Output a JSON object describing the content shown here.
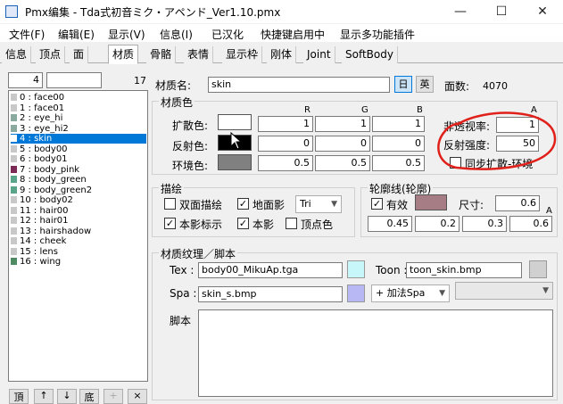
{
  "window": {
    "title": "Pmx编集 - Tda式初音ミク・アペンド_Ver1.10.pmx",
    "min": "—",
    "max": "☐",
    "close": "✕"
  },
  "menu": [
    "文件(F)",
    "编辑(E)",
    "显示(V)",
    "信息(I)",
    "已汉化",
    "快捷键启用中",
    "显示多功能插件"
  ],
  "tabs": [
    "信息",
    "顶点",
    "面",
    "材质",
    "骨骼",
    "表情",
    "显示枠",
    "刚体",
    "Joint",
    "SoftBody"
  ],
  "active_tab": "材质",
  "list": {
    "index": "4",
    "count": "17",
    "items": [
      {
        "label": "0 : face00",
        "color": "#c8c8c8"
      },
      {
        "label": "1 : face01",
        "color": "#c8c8c8"
      },
      {
        "label": "2 : eye_hi",
        "color": "#8aaaa0"
      },
      {
        "label": "3 : eye_hi2",
        "color": "#8aaaa0"
      },
      {
        "label": "4 : skin",
        "color": "#ffffff"
      },
      {
        "label": "5 : body00",
        "color": "#c8c8c8"
      },
      {
        "label": "6 : body01",
        "color": "#c8c8c8"
      },
      {
        "label": "7 : body_pink",
        "color": "#7a2a55"
      },
      {
        "label": "8 : body_green",
        "color": "#5aa58a"
      },
      {
        "label": "9 : body_green2",
        "color": "#5aa58a"
      },
      {
        "label": "10 : body02",
        "color": "#c8c8c8"
      },
      {
        "label": "11 : hair00",
        "color": "#c8c8c8"
      },
      {
        "label": "12 : hair01",
        "color": "#c8c8c8"
      },
      {
        "label": "13 : hairshadow",
        "color": "#c8c8c8"
      },
      {
        "label": "14 : cheek",
        "color": "#c8c8c8"
      },
      {
        "label": "15 : lens",
        "color": "#c8c8c8"
      },
      {
        "label": "16 : wing",
        "color": "#4e8a62"
      }
    ],
    "selected_index": 4,
    "buttons": [
      "頂",
      "↑",
      "↓",
      "底",
      "+",
      "×"
    ]
  },
  "material": {
    "name_label": "材质名:",
    "name": "skin",
    "lang_jp": "日",
    "lang_en": "英",
    "face_label": "面数:",
    "face_count": "4070",
    "color_group": "材质色",
    "col_R": "R",
    "col_G": "G",
    "col_B": "B",
    "col_A": "A",
    "diffuse_label": "扩散色:",
    "diffuse": [
      "1",
      "1",
      "1"
    ],
    "specular_label": "反射色:",
    "specular": [
      "0",
      "0",
      "0"
    ],
    "ambient_label": "环境色:",
    "ambient": [
      "0.5",
      "0.5",
      "0.5"
    ],
    "alpha_label": "非透视率:",
    "alpha": "1",
    "spec_power_label": "反射强度:",
    "spec_power": "50",
    "sync_label": "同步扩散-环境",
    "draw_group": "描绘",
    "double_side": "双面描绘",
    "ground_shadow": "地面影",
    "mode": "Tri",
    "self_shadow_map": "本影标示",
    "self_shadow": "本影",
    "vertex_color": "顶点色",
    "edge_group": "轮廓线(轮廓)",
    "edge_enabled": "有效",
    "edge_size_label": "尺寸:",
    "edge_size": "0.6",
    "edge_color": [
      "0.45",
      "0.2",
      "0.3",
      "0.6"
    ],
    "edge_A": "A",
    "texture_group": "材质纹理／脚本",
    "tex_label": "Tex :",
    "tex": "body00_MikuAp.tga",
    "toon_label": "Toon :",
    "toon": "toon_skin.bmp",
    "spa_label": "Spa :",
    "spa": "skin_s.bmp",
    "spa_mode": "+ 加法Spa",
    "script_label": "脚本"
  }
}
